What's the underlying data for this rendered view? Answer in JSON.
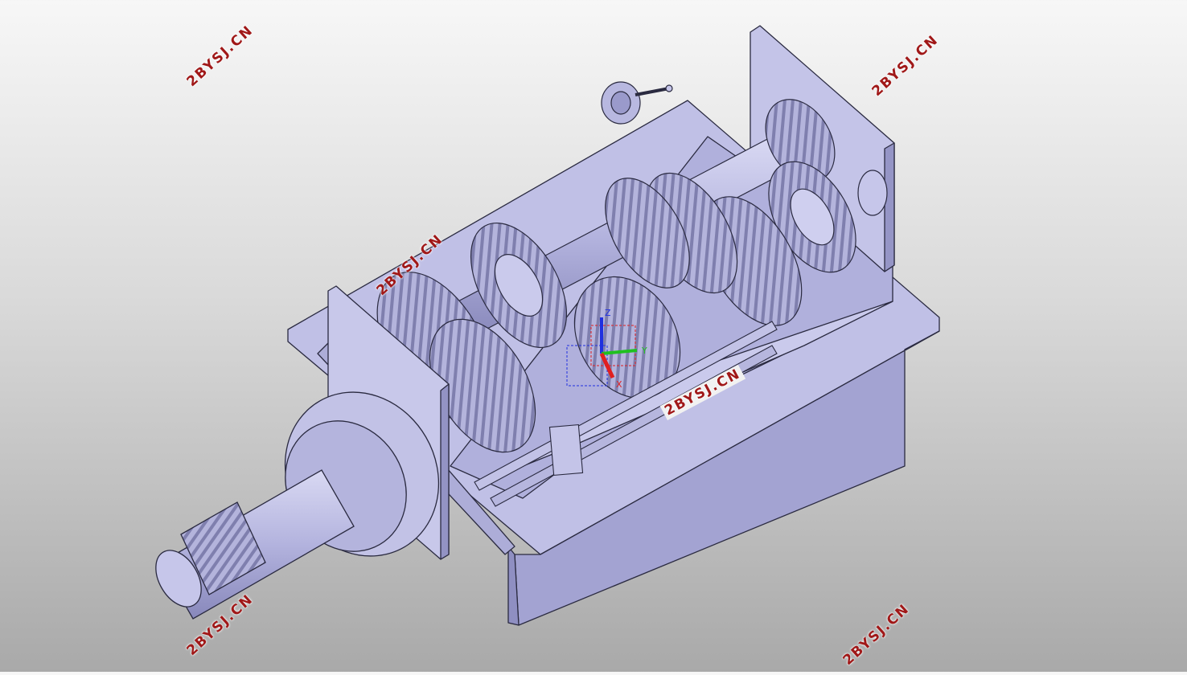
{
  "viewport": {
    "background_top": "#f7f7f7",
    "background_bottom": "#a9a9a9",
    "model_fill": "#b9b9e0",
    "model_fill_dark": "#8d8dbf",
    "model_fill_light": "#d6d6f2",
    "edge_color": "#2a2a40"
  },
  "watermarks": [
    "2BYSJ.CN",
    "2BYSJ.CN",
    "2BYSJ.CN",
    "2BYSJ.CN",
    "2BYSJ.CN",
    "2BYSJ.CN"
  ],
  "watermark_color": "#a01818",
  "triad": {
    "x_label": "X",
    "y_label": "Y",
    "z_label": "Z",
    "x_color": "#e02020",
    "y_color": "#20c020",
    "z_color": "#2030e0"
  },
  "icons": [
    "coordinate-triad-icon"
  ]
}
